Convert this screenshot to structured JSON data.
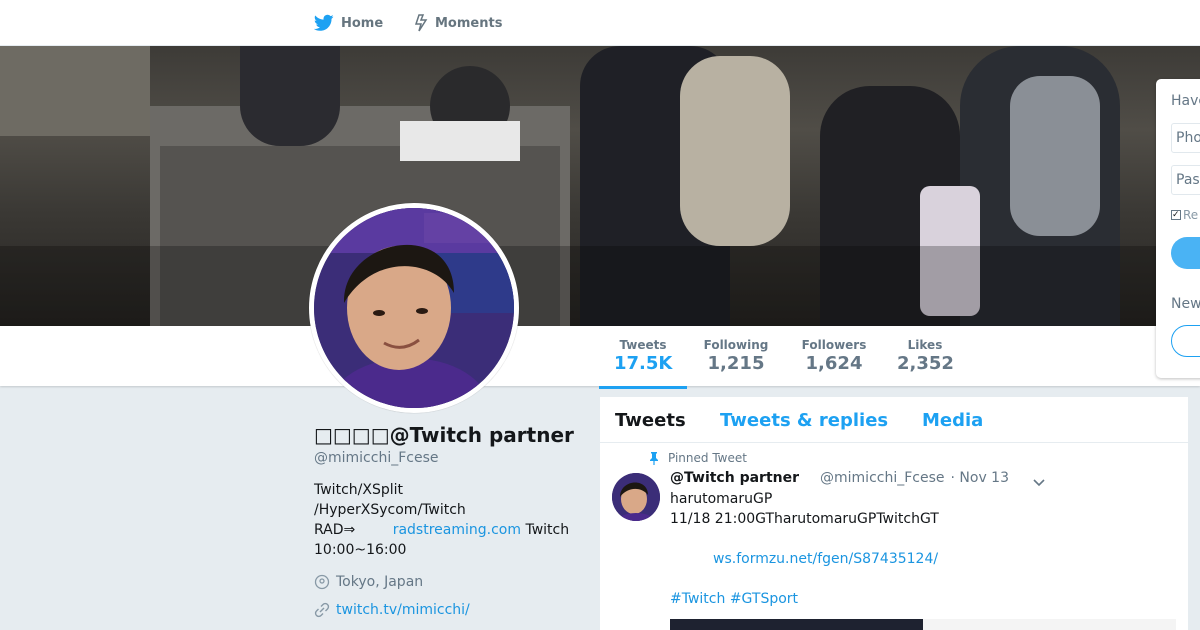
{
  "nav": {
    "home_label": "Home",
    "moments_label": "Moments"
  },
  "stats": [
    {
      "label": "Tweets",
      "value": "17.5K",
      "active": true
    },
    {
      "label": "Following",
      "value": "1,215",
      "active": false
    },
    {
      "label": "Followers",
      "value": "1,624",
      "active": false
    },
    {
      "label": "Likes",
      "value": "2,352",
      "active": false
    }
  ],
  "profile": {
    "name": "□□□□@Twitch partner",
    "handle": "@mimicchi_Fcese",
    "bio_line1": "Twitch/XSplit",
    "bio_line2": "/HyperXSycom/Twitch",
    "bio_line3_prefix": "RAD⇒",
    "bio_line3_link": "radstreaming.com",
    "bio_line3_suffix": "Twitch",
    "bio_line4": "10:00~16:00",
    "location": "Tokyo, Japan",
    "url": "twitch.tv/mimicchi/"
  },
  "tabs": {
    "tweets": "Tweets",
    "replies": "Tweets & replies",
    "media": "Media"
  },
  "tweet": {
    "pinned_label": "Pinned Tweet",
    "name": "@Twitch partner",
    "handle": "@mimicchi_Fcese",
    "date": "· Nov 13",
    "line1": "harutomaruGP",
    "line2": "11/18 21:00GTharutomaruGPTwitchGT",
    "link": "ws.formzu.net/fgen/S87435124/",
    "hashtag1": "#Twitch",
    "hashtag2": "#GTSport"
  },
  "login": {
    "have_account": "Have",
    "phone_placeholder": "Pho",
    "password_placeholder": "Pas",
    "remember": "Re",
    "new_to": "New"
  },
  "colors": {
    "accent": "#1da1f2",
    "link": "#1b95e0",
    "background": "#e6ecf0"
  }
}
